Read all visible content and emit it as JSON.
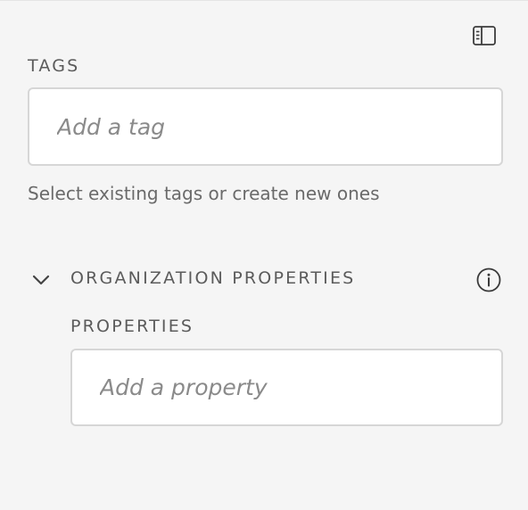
{
  "tags": {
    "label": "TAGS",
    "placeholder": "Add a tag",
    "helper": "Select existing tags or create new ones"
  },
  "org_properties": {
    "title": "ORGANIZATION PROPERTIES",
    "expanded": true,
    "properties_label": "PROPERTIES",
    "properties_placeholder": "Add a property"
  },
  "icons": {
    "panel_toggle": "sidebar-panel-icon",
    "collapse": "chevron-down-icon",
    "info": "info-icon"
  },
  "colors": {
    "background": "#f5f5f5",
    "label": "#5b5b5b",
    "field_border": "#d6d6d6"
  }
}
